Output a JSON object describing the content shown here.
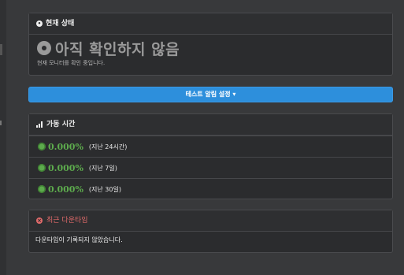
{
  "current_status": {
    "header_label": "현재 상태",
    "status_text": "아직 확인하지 않음",
    "status_sub": "현재 모니터를 확인 중입니다."
  },
  "alert_button": {
    "label": "테스트 알림 설정 ▾"
  },
  "uptime": {
    "header_label": "가동 시간",
    "rows": [
      {
        "percent": "0.000%",
        "period": "(지난 24시간)"
      },
      {
        "percent": "0.000%",
        "period": "(지난 7일)"
      },
      {
        "percent": "0.000%",
        "period": "(지난 30일)"
      }
    ]
  },
  "downtime": {
    "header_label": "최근 다운타임",
    "message": "다운타임이 기록되지 않았습니다."
  },
  "colors": {
    "accent_blue": "#2d8fdc",
    "uptime_green": "#5dab4d",
    "downtime_red": "#e06a6a",
    "status_gray": "#9a9a9a"
  },
  "icons": {
    "status_header": "info-circle-icon",
    "status_big": "disc-icon",
    "uptime_header": "bar-chart-icon",
    "uptime_row": "gear-icon",
    "downtime_header": "x-circle-icon"
  }
}
